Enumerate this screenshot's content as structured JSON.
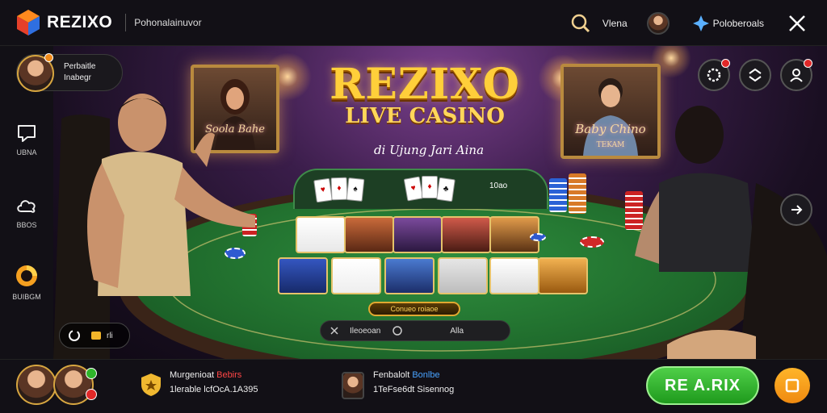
{
  "header": {
    "brand": "REZIXO",
    "subtitle": "Pohonalainuvor",
    "search_label": "Vlena",
    "profile_label": "Poloberoals"
  },
  "host": {
    "name": "Perbaitle",
    "status": "Inabegr"
  },
  "sidebar": {
    "items": [
      {
        "label": "UBNA",
        "icon": "chat-bubble-icon"
      },
      {
        "label": "BBOS",
        "icon": "cloud-icon"
      },
      {
        "label": "BUIBGM",
        "icon": "spin-icon"
      }
    ]
  },
  "hero": {
    "title": "REZIXO",
    "subtitle": "LIVE CASINO",
    "tagline": "di Ujung Jari Aina"
  },
  "frames": {
    "left": "Soola Bahe",
    "right": "Baby Chino",
    "right_sub": "TEKAM"
  },
  "table": {
    "timer_label": "10ao",
    "bet_label": "Conueo roiaoe",
    "info_left": "Ileoeoan",
    "info_right": "Alla",
    "wallet_value": "rli"
  },
  "footer": {
    "player1_title": "Murgenioat",
    "player1_highlight": "Bebirs",
    "player1_line2": "1lerable lcfOcA.1A395",
    "player2_title": "Fenbalolt",
    "player2_highlight": "Bonlbe",
    "player2_line2": "1TeFse6dt Sisennog",
    "cta_label": "RE A.RIX"
  },
  "colors": {
    "cta_green": "#2fb52a",
    "title_gold": "#ffcf3a",
    "badge_red": "#e02828",
    "felt_green": "#1f6b2c"
  }
}
